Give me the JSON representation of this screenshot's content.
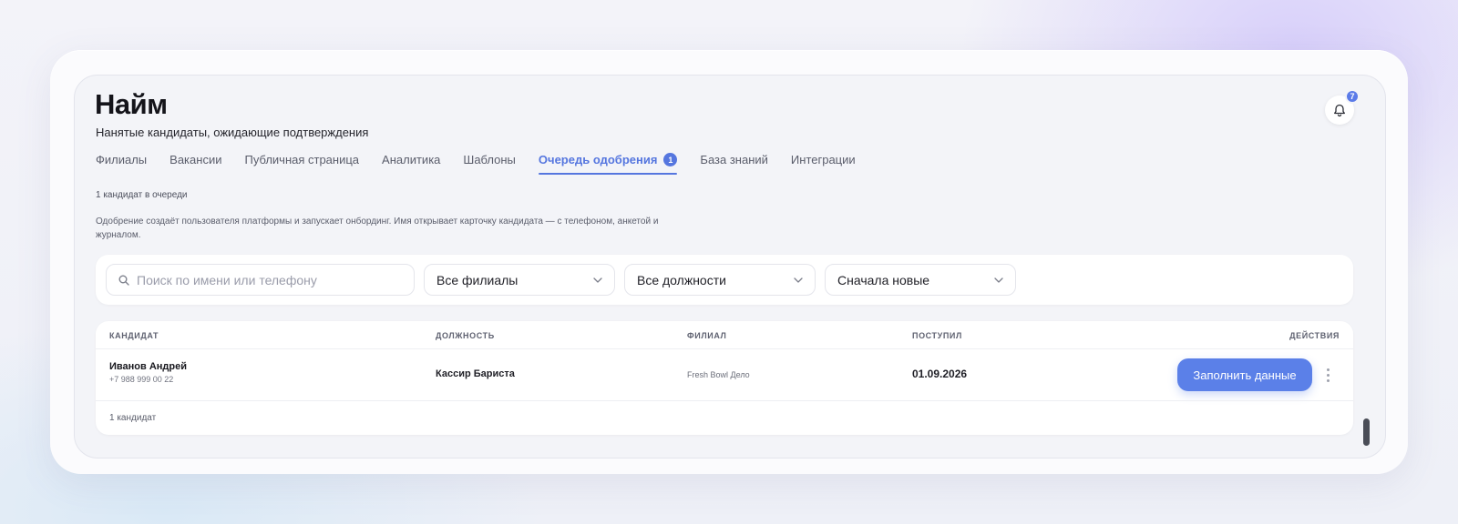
{
  "header": {
    "title": "Найм",
    "subtitle": "Нанятые кандидаты, ожидающие подтверждения",
    "notifications_count": "7"
  },
  "tabs": [
    {
      "label": "Филиалы",
      "active": false
    },
    {
      "label": "Вакансии",
      "active": false
    },
    {
      "label": "Публичная страница",
      "active": false
    },
    {
      "label": "Аналитика",
      "active": false
    },
    {
      "label": "Шаблоны",
      "active": false
    },
    {
      "label": "Очередь одобрения",
      "active": true,
      "count": "1"
    },
    {
      "label": "База знаний",
      "active": false
    },
    {
      "label": "Интеграции",
      "active": false
    }
  ],
  "queue": {
    "count_text": "1 кандидат в очереди",
    "help_text": "Одобрение создаёт пользователя платформы и запускает онбординг. Имя открывает карточку кандидата — с телефоном, анкетой и журналом."
  },
  "filters": {
    "search_placeholder": "Поиск по имени или телефону",
    "search_value": "",
    "branch_select": "Все филиалы",
    "position_select": "Все должности",
    "sort_select": "Сначала новые"
  },
  "table": {
    "columns": [
      "КАНДИДАТ",
      "ДОЛЖНОСТЬ",
      "ФИЛИАЛ",
      "ПОСТУПИЛ",
      "ДЕЙСТВИЯ"
    ],
    "rows": [
      {
        "name": "Иванов Андрей",
        "phone": "+7 988 999 00 22",
        "position": "Кассир Бариста",
        "branch": "Fresh Bowl Дело",
        "received": "01.09.2026",
        "action_label": "Заполнить данные"
      }
    ],
    "footer_count": "1 кандидат"
  },
  "colors": {
    "accent": "#5b80e8",
    "tab_active": "#5576df"
  },
  "icons": {
    "bell": "bell-icon",
    "search": "search-icon",
    "chevron": "chevron-down-icon",
    "kebab": "more-vertical-icon"
  }
}
